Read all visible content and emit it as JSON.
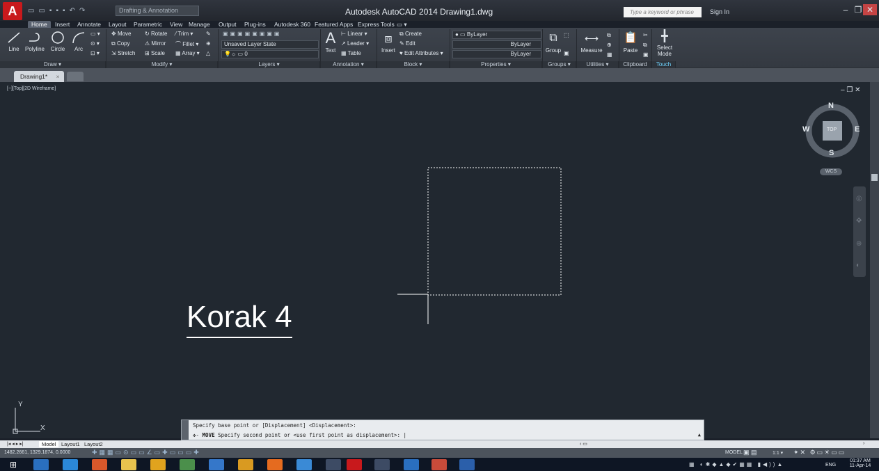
{
  "titlebar": {
    "app_logo": "A",
    "workspace": "Drafting & Annotation",
    "title": "Autodesk AutoCAD 2014    Drawing1.dwg",
    "search_placeholder": "Type a keyword or phrase",
    "sign_in": "Sign In"
  },
  "ribbon_tabs": [
    "Home",
    "Insert",
    "Annotate",
    "Layout",
    "Parametric",
    "View",
    "Manage",
    "Output",
    "Plug-ins",
    "Autodesk 360",
    "Featured Apps",
    "Express Tools"
  ],
  "draw": {
    "title": "Draw ▾",
    "line": "Line",
    "polyline": "Polyline",
    "circle": "Circle",
    "arc": "Arc"
  },
  "modify": {
    "title": "Modify ▾",
    "move": "Move",
    "rotate": "Rotate",
    "trim": "Trim ▾",
    "copy": "Copy",
    "mirror": "Mirror",
    "fillet": "Fillet ▾",
    "stretch": "Stretch",
    "scale": "Scale",
    "array": "Array ▾"
  },
  "layers": {
    "title": "Layers ▾",
    "state": "Unsaved Layer State",
    "current": "0"
  },
  "annotation": {
    "title": "Annotation ▾",
    "text": "Text",
    "linear": "Linear ▾",
    "leader": "Leader ▾",
    "table": "Table"
  },
  "block": {
    "title": "Block ▾",
    "insert": "Insert",
    "create": "Create",
    "edit": "Edit",
    "edit_attributes": "Edit Attributes ▾"
  },
  "properties": {
    "title": "Properties ▾",
    "color": "ByLayer",
    "lineweight": "ByLayer",
    "linetype": "ByLayer"
  },
  "groups": {
    "title": "Groups ▾",
    "group": "Group"
  },
  "utilities": {
    "title": "Utilities ▾",
    "measure": "Measure"
  },
  "clipboard": {
    "title": "Clipboard",
    "paste": "Paste"
  },
  "touch": {
    "title": "Touch",
    "select_mode_1": "Select",
    "select_mode_2": "Mode"
  },
  "document": {
    "tab": "Drawing1*"
  },
  "viewport": {
    "label": "[−][Top][2D Wireframe]",
    "viewcube": {
      "n": "N",
      "s": "S",
      "e": "E",
      "w": "W",
      "top": "TOP",
      "wcs": "WCS"
    },
    "ucs_x": "X",
    "ucs_y": "Y"
  },
  "overlay_text": "Korak 4",
  "command": {
    "history": "Specify base point or [Displacement] <Displacement>:",
    "command_name": "MOVE",
    "prompt": "Specify second point or <use first point as displacement>:"
  },
  "layouts": [
    "Model",
    "Layout1",
    "Layout2"
  ],
  "status": {
    "coords": "1482.2661, 1329.1874, 0.0000",
    "model": "MODEL",
    "scale": "1:1 ▾"
  },
  "taskbar": {
    "lang": "ENG",
    "time": "01:37 AM",
    "date": "11-Apr-14"
  },
  "colors": {
    "canvas": "#212830",
    "accent_red": "#c8191c",
    "ribbon": "#3b4048"
  }
}
